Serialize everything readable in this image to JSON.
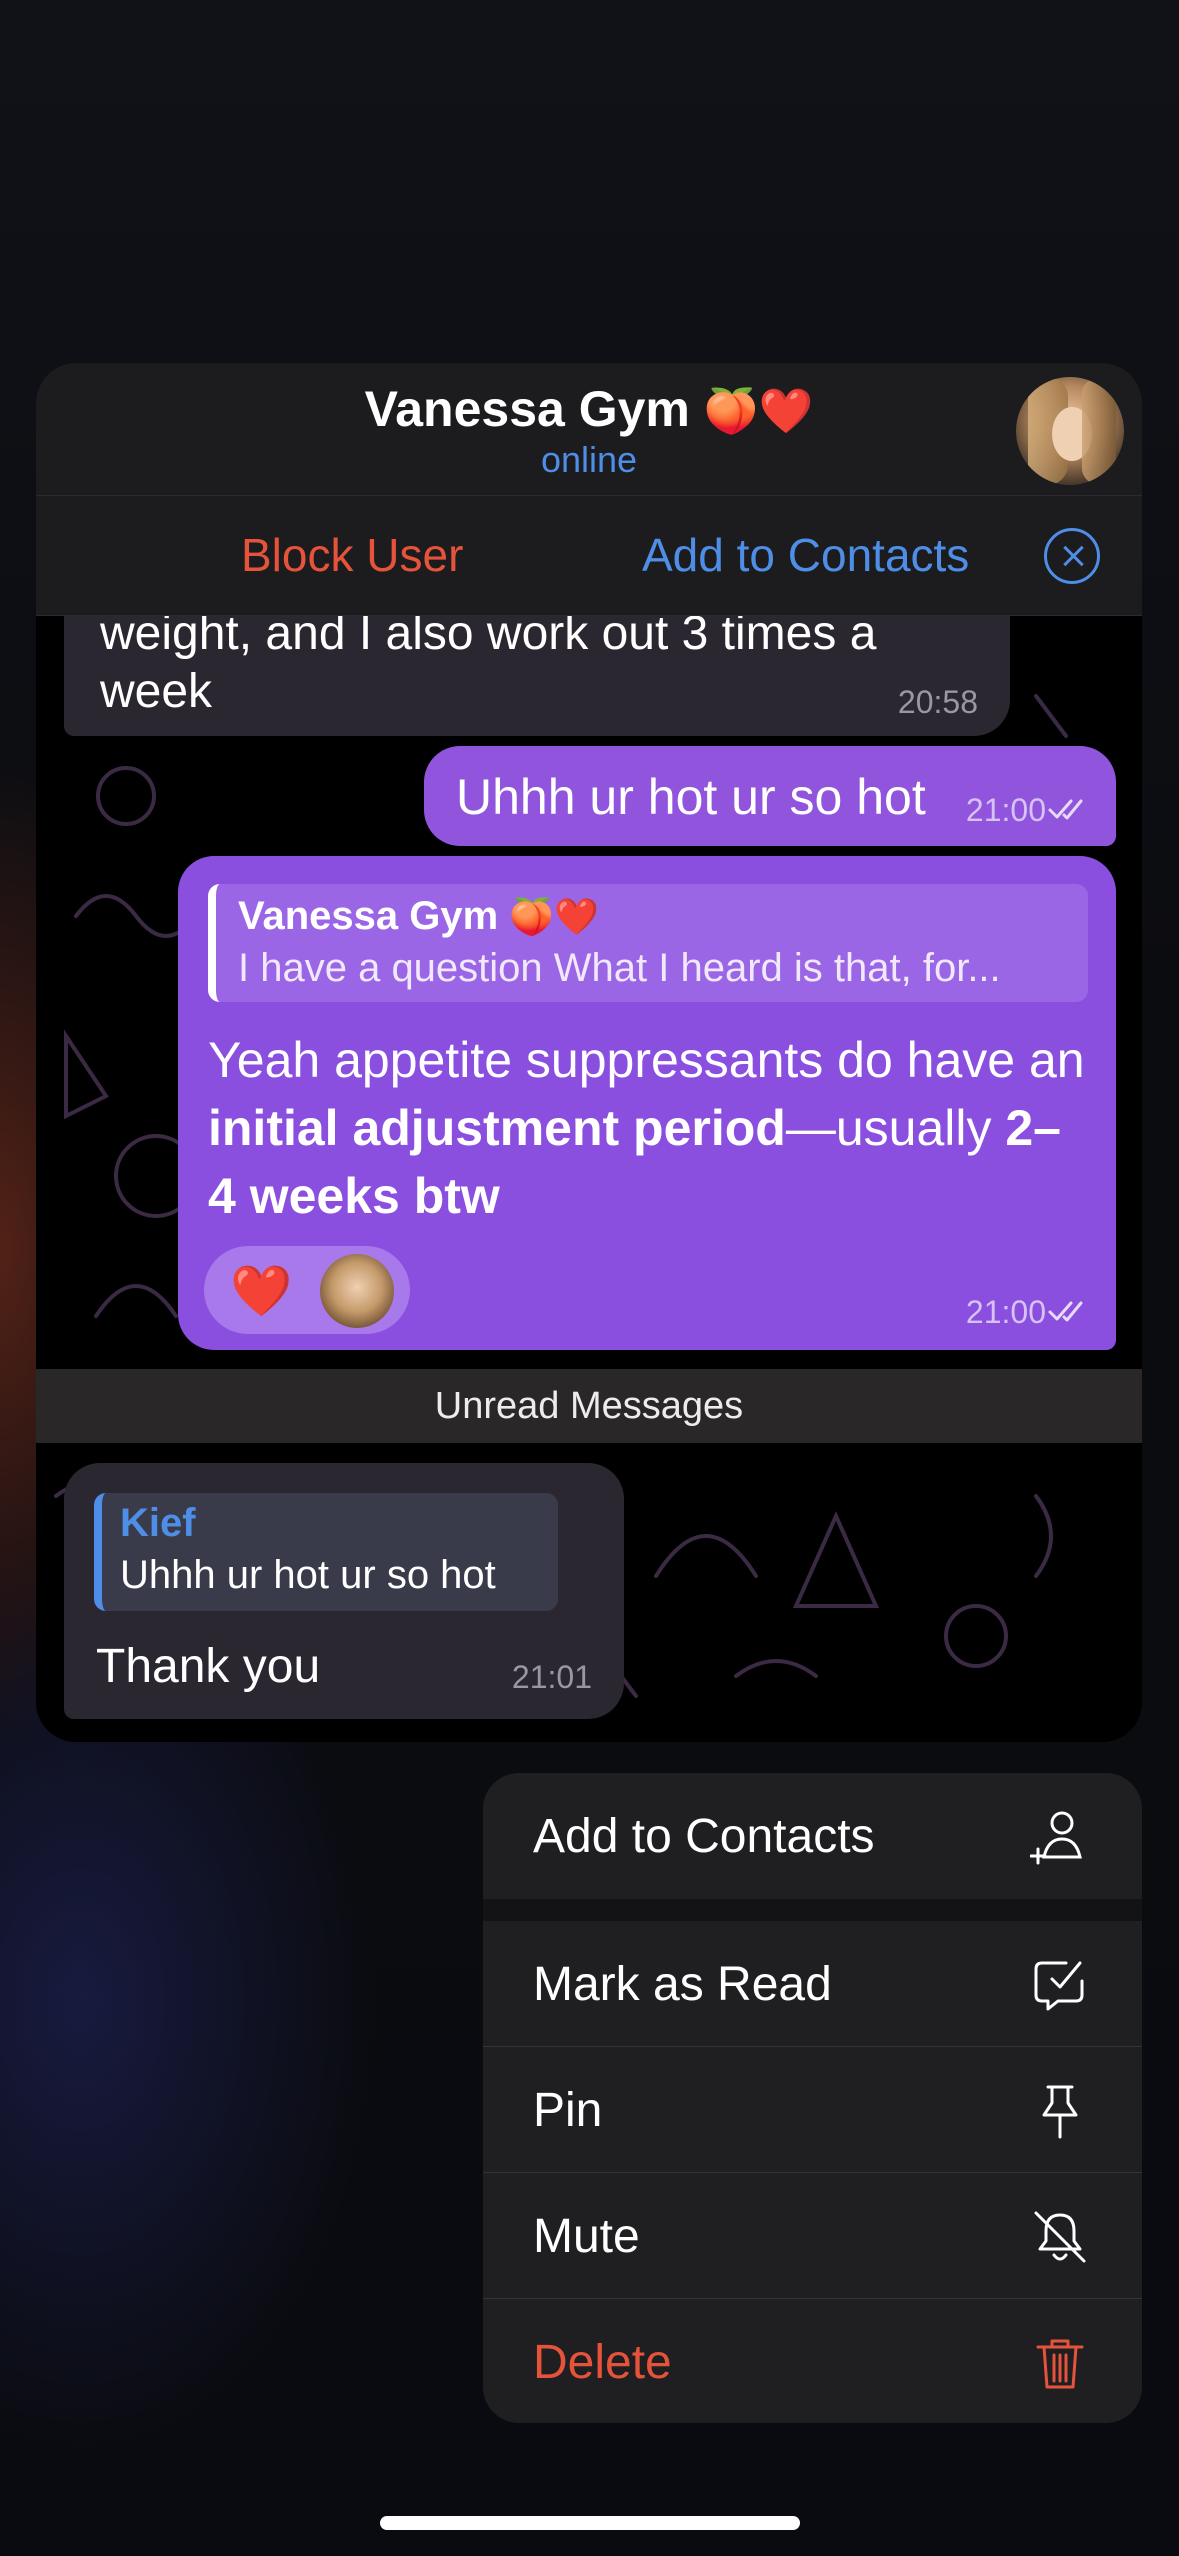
{
  "preview": {
    "contact_name": "Vanessa Gym",
    "contact_emoji": "🍑❤️",
    "status": "online",
    "block_label": "Block User",
    "add_contacts_label": "Add to Contacts"
  },
  "messages": [
    {
      "direction": "in",
      "line1": "weight, and I also work out 3 times a",
      "line2": "week",
      "time": "20:58"
    },
    {
      "direction": "out",
      "text": "Uhhh ur hot ur so hot",
      "time": "21:00"
    },
    {
      "direction": "out",
      "reply_name": "Vanessa Gym",
      "reply_emoji": "🍑❤️",
      "reply_text": "I have a question What I heard is that, for...",
      "body_pre": "Yeah appetite suppressants do have an ",
      "body_bold1": "initial adjustment period",
      "body_mid": "—usually ",
      "body_bold2": "2–4 weeks btw",
      "reaction": "❤️",
      "time": "21:00"
    },
    {
      "direction": "in",
      "reply_name": "Kief",
      "reply_text": "Uhhh ur hot ur so hot",
      "text": "Thank you",
      "time": "21:01"
    }
  ],
  "unread_label": "Unread Messages",
  "menu": {
    "items": [
      {
        "label": "Add to Contacts",
        "icon": "add-contact-icon"
      },
      {
        "label": "Mark as Read",
        "icon": "mark-read-icon"
      },
      {
        "label": "Pin",
        "icon": "pin-icon"
      },
      {
        "label": "Mute",
        "icon": "bell-off-icon"
      },
      {
        "label": "Delete",
        "icon": "trash-icon"
      }
    ]
  },
  "colors": {
    "accent_blue": "#4e8ee6",
    "destructive_red": "#e5533b",
    "outgoing_bubble": "#8b4fe0",
    "incoming_bubble": "#2b2730"
  }
}
